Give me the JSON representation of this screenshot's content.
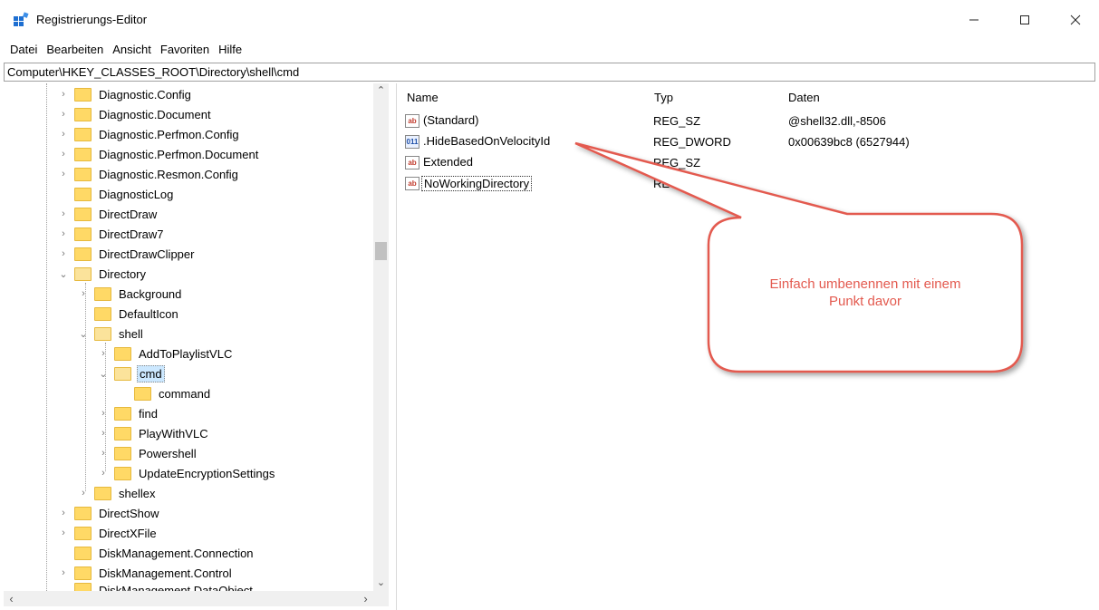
{
  "window": {
    "title": "Registrierungs-Editor",
    "minimize_icon": "minimize-icon",
    "maximize_icon": "maximize-icon",
    "close_icon": "close-icon"
  },
  "menu": [
    "Datei",
    "Bearbeiten",
    "Ansicht",
    "Favoriten",
    "Hilfe"
  ],
  "address": "Computer\\HKEY_CLASSES_ROOT\\Directory\\shell\\cmd",
  "tree": [
    {
      "label": "Diagnostic.Config"
    },
    {
      "label": "Diagnostic.Document"
    },
    {
      "label": "Diagnostic.Perfmon.Config"
    },
    {
      "label": "Diagnostic.Perfmon.Document"
    },
    {
      "label": "Diagnostic.Resmon.Config"
    },
    {
      "label": "DiagnosticLog"
    },
    {
      "label": "DirectDraw"
    },
    {
      "label": "DirectDraw7"
    },
    {
      "label": "DirectDrawClipper"
    },
    {
      "label": "Directory"
    },
    {
      "label": "Background"
    },
    {
      "label": "DefaultIcon"
    },
    {
      "label": "shell"
    },
    {
      "label": "AddToPlaylistVLC"
    },
    {
      "label": "cmd"
    },
    {
      "label": "command"
    },
    {
      "label": "find"
    },
    {
      "label": "PlayWithVLC"
    },
    {
      "label": "Powershell"
    },
    {
      "label": "UpdateEncryptionSettings"
    },
    {
      "label": "shellex"
    },
    {
      "label": "DirectShow"
    },
    {
      "label": "DirectXFile"
    },
    {
      "label": "DiskManagement.Connection"
    },
    {
      "label": "DiskManagement.Control"
    },
    {
      "label": "DiskManagement.DataObject"
    }
  ],
  "columns": {
    "name": "Name",
    "type": "Typ",
    "data": "Daten"
  },
  "values": [
    {
      "icon": "ab",
      "name": "(Standard)",
      "type": "REG_SZ",
      "data": "@shell32.dll,-8506"
    },
    {
      "icon": "011",
      "name": ".HideBasedOnVelocityId",
      "type": "REG_DWORD",
      "data": "0x00639bc8 (6527944)"
    },
    {
      "icon": "ab",
      "name": "Extended",
      "type": "REG_SZ",
      "data": ""
    },
    {
      "icon": "ab",
      "name": "NoWorkingDirectory",
      "type": "REG_SZ",
      "data": ""
    }
  ],
  "callout": {
    "line1": "Einfach umbenennen mit einem",
    "line2": "Punkt davor",
    "color": "#e35a4f"
  }
}
